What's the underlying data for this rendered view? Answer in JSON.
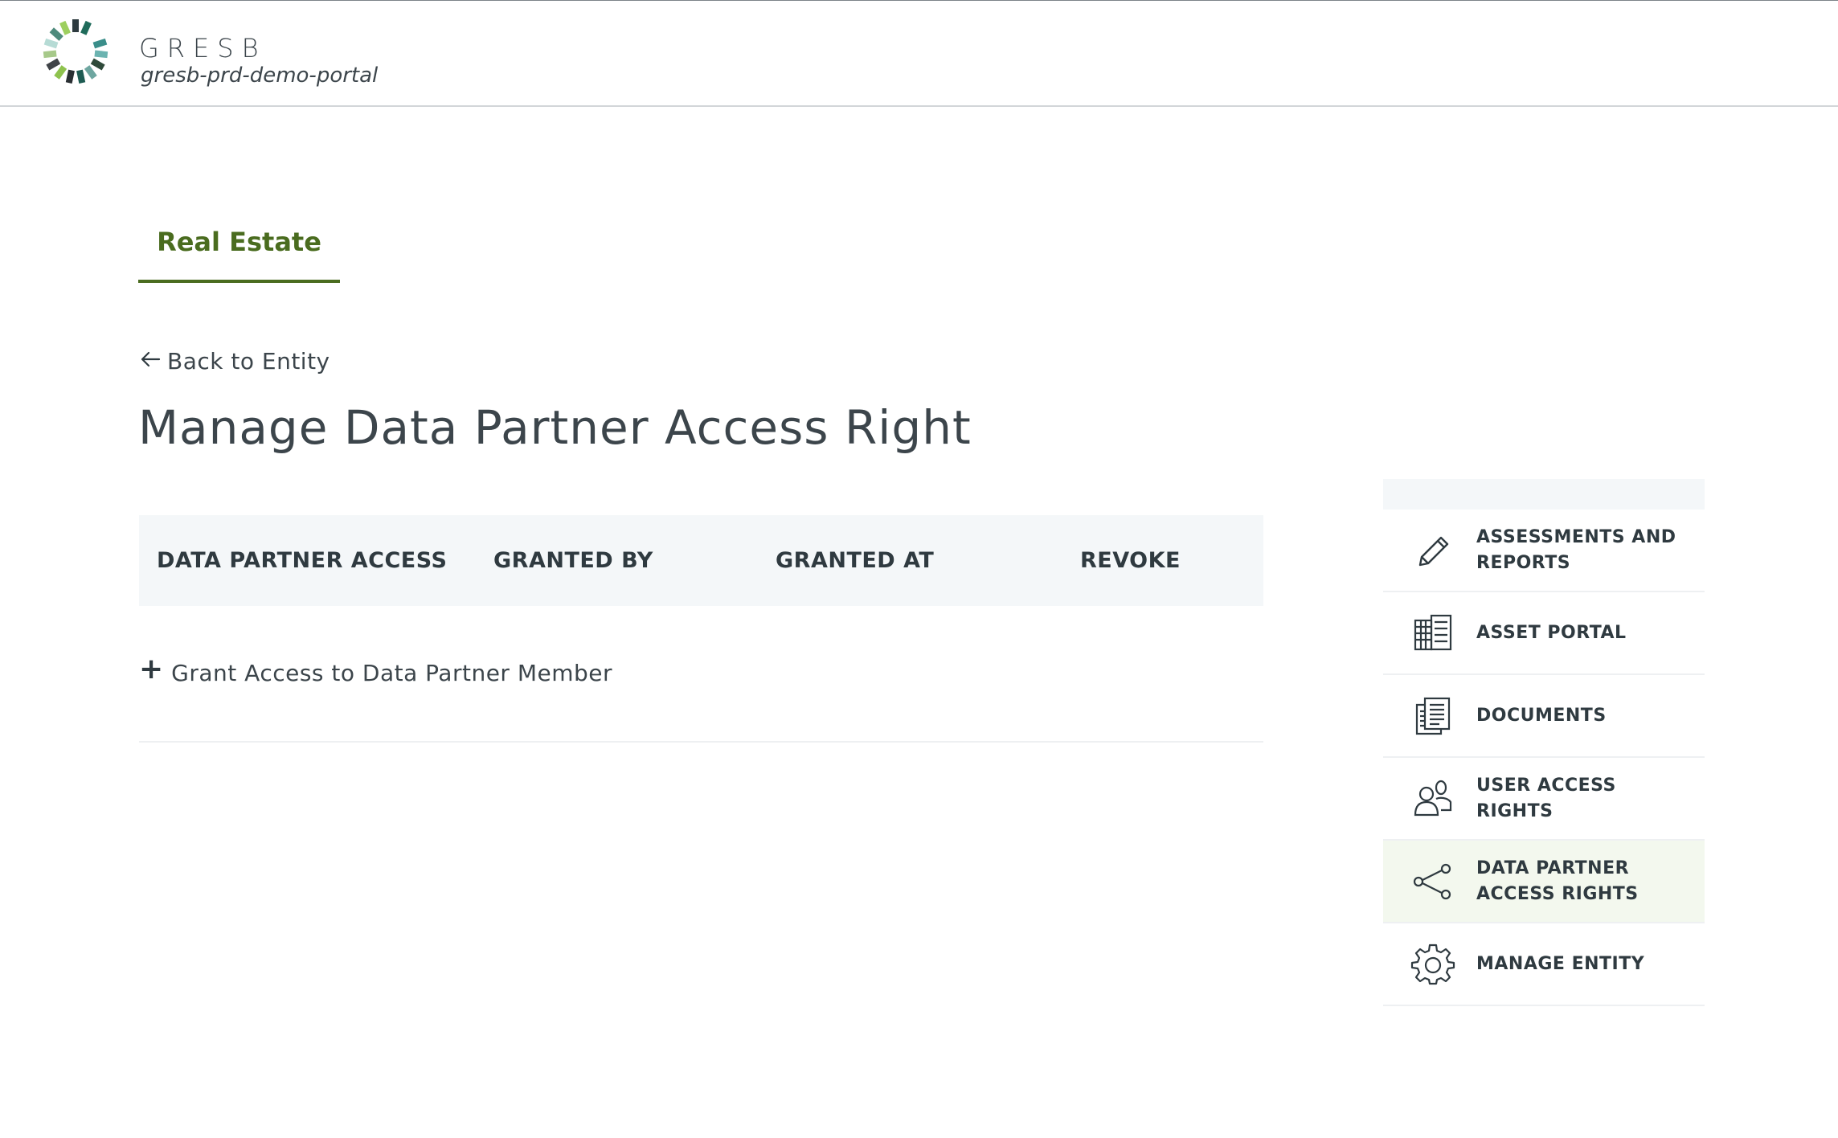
{
  "header": {
    "brand": "GRESB",
    "portal": "gresb-prd-demo-portal"
  },
  "tabs": [
    {
      "label": "Real Estate",
      "active": true
    }
  ],
  "back_link": {
    "label": "Back to Entity",
    "icon": "arrow-left-icon"
  },
  "page_title": "Manage Data Partner Access Right",
  "table": {
    "columns": [
      "DATA PARTNER ACCESS",
      "GRANTED BY",
      "GRANTED AT",
      "REVOKE"
    ],
    "rows": [],
    "grant_action": {
      "label": "Grant Access to Data Partner Member",
      "icon": "plus-icon"
    }
  },
  "side_menu": {
    "items": [
      {
        "label": "ASSESSMENTS AND REPORTS",
        "icon": "pencil-icon",
        "active": false
      },
      {
        "label": "ASSET PORTAL",
        "icon": "buildings-icon",
        "active": false
      },
      {
        "label": "DOCUMENTS",
        "icon": "documents-icon",
        "active": false
      },
      {
        "label": "USER ACCESS RIGHTS",
        "icon": "users-icon",
        "active": false
      },
      {
        "label": "DATA PARTNER ACCESS RIGHTS",
        "icon": "share-icon",
        "active": true
      },
      {
        "label": "MANAGE ENTITY",
        "icon": "gear-icon",
        "active": false
      }
    ]
  },
  "colors": {
    "accent": "#4a6c1f",
    "table_header_bg": "#f4f7f9",
    "active_menu_bg": "#f3f8ee",
    "text": "#2f3a40"
  }
}
